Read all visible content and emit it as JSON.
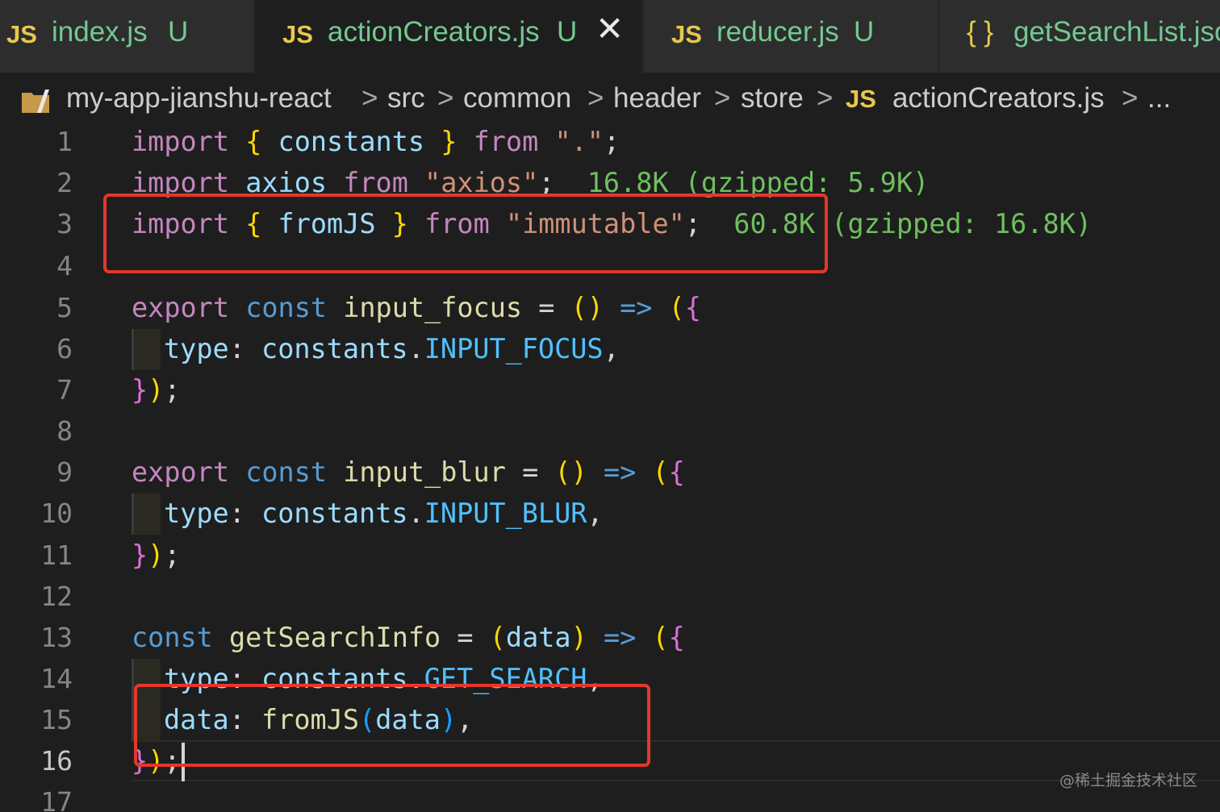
{
  "tabs": [
    {
      "icon": "JS",
      "icon_type": "js-file-icon",
      "name": "index.js",
      "status": "U",
      "active": false
    },
    {
      "icon": "JS",
      "icon_type": "js-file-icon",
      "name": "actionCreators.js",
      "status": "U",
      "active": true,
      "close": "✕"
    },
    {
      "icon": "JS",
      "icon_type": "js-file-icon",
      "name": "reducer.js",
      "status": "U",
      "active": false
    },
    {
      "icon": "{ }",
      "icon_type": "json-file-icon",
      "name": "getSearchList.json",
      "status": "",
      "active": false
    }
  ],
  "breadcrumb": {
    "items": [
      "my-app-jianshu-react",
      "src",
      "common",
      "header",
      "store"
    ],
    "file_icon": "JS",
    "file": "actionCreators.js",
    "more": "...",
    "separator": ">"
  },
  "editor": {
    "line_numbers": [
      "1",
      "2",
      "3",
      "4",
      "5",
      "6",
      "7",
      "8",
      "9",
      "10",
      "11",
      "12",
      "13",
      "14",
      "15",
      "16",
      "17"
    ],
    "current_line": "16",
    "lines": {
      "l1": {
        "t1": "import",
        "t2": "{",
        "t3": "constants",
        "t4": "}",
        "t5": "from",
        "t6": "\".\"",
        "t7": ";"
      },
      "l2": {
        "t1": "import",
        "t2": "axios",
        "t3": "from",
        "t4": "\"axios\"",
        "t5": ";",
        "hint": "16.8K (gzipped: 5.9K)"
      },
      "l3": {
        "t1": "import",
        "t2": "{",
        "t3": "fromJS",
        "t4": "}",
        "t5": "from",
        "t6": "\"immutable\"",
        "t7": ";",
        "hint": "60.8K (gzipped: 16.8K)"
      },
      "l5": {
        "t1": "export",
        "t2": "const",
        "t3": "input_focus",
        "t4": "=",
        "t5": "()",
        "t6": "=>",
        "t7": "(",
        "t8": "{"
      },
      "l6": {
        "t1": "type",
        "t2": ":",
        "t3": "constants",
        "t4": ".",
        "t5": "INPUT_FOCUS",
        "t6": ","
      },
      "l7": {
        "t1": "}",
        "t2": ")",
        "t3": ";"
      },
      "l9": {
        "t1": "export",
        "t2": "const",
        "t3": "input_blur",
        "t4": "=",
        "t5": "()",
        "t6": "=>",
        "t7": "(",
        "t8": "{"
      },
      "l10": {
        "t1": "type",
        "t2": ":",
        "t3": "constants",
        "t4": ".",
        "t5": "INPUT_BLUR",
        "t6": ","
      },
      "l11": {
        "t1": "}",
        "t2": ")",
        "t3": ";"
      },
      "l13": {
        "t1": "const",
        "t2": "getSearchInfo",
        "t3": "=",
        "t4": "(",
        "t5": "data",
        "t6": ")",
        "t7": "=>",
        "t8": "(",
        "t9": "{"
      },
      "l14": {
        "t1": "type",
        "t2": ":",
        "t3": "constants",
        "t4": ".",
        "t5": "GET_SEARCH",
        "t6": ","
      },
      "l15": {
        "t1": "data",
        "t2": ":",
        "t3": "fromJS",
        "t4": "(",
        "t5": "data",
        "t6": ")",
        "t7": ","
      },
      "l16": {
        "t1": "}",
        "t2": ")",
        "t3": ";"
      }
    }
  },
  "watermark": "@稀土掘金技术社区",
  "colors": {
    "annotation": "#e5372a",
    "modified": "#73c991",
    "js_icon": "#e6c84e"
  }
}
